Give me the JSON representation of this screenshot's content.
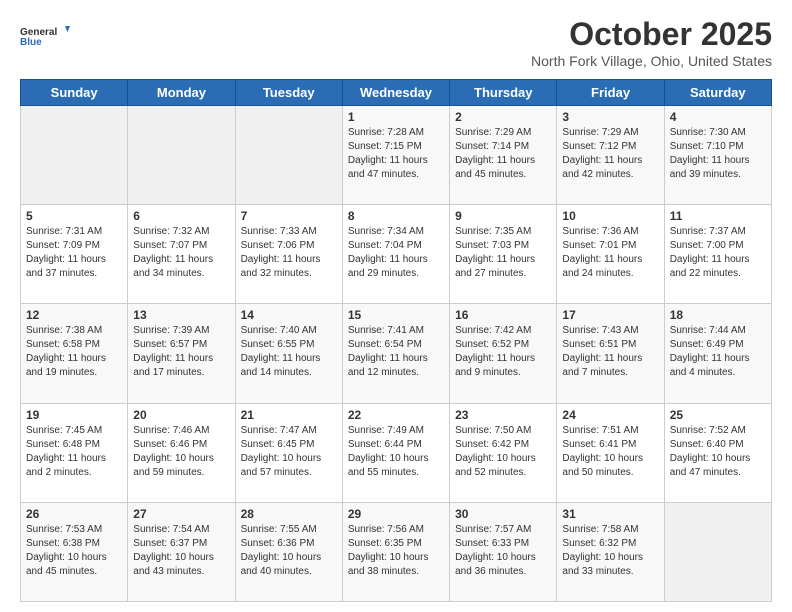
{
  "logo": {
    "line1": "General",
    "line2": "Blue"
  },
  "header": {
    "month": "October 2025",
    "location": "North Fork Village, Ohio, United States"
  },
  "days_of_week": [
    "Sunday",
    "Monday",
    "Tuesday",
    "Wednesday",
    "Thursday",
    "Friday",
    "Saturday"
  ],
  "weeks": [
    [
      {
        "day": "",
        "info": ""
      },
      {
        "day": "",
        "info": ""
      },
      {
        "day": "",
        "info": ""
      },
      {
        "day": "1",
        "info": "Sunrise: 7:28 AM\nSunset: 7:15 PM\nDaylight: 11 hours\nand 47 minutes."
      },
      {
        "day": "2",
        "info": "Sunrise: 7:29 AM\nSunset: 7:14 PM\nDaylight: 11 hours\nand 45 minutes."
      },
      {
        "day": "3",
        "info": "Sunrise: 7:29 AM\nSunset: 7:12 PM\nDaylight: 11 hours\nand 42 minutes."
      },
      {
        "day": "4",
        "info": "Sunrise: 7:30 AM\nSunset: 7:10 PM\nDaylight: 11 hours\nand 39 minutes."
      }
    ],
    [
      {
        "day": "5",
        "info": "Sunrise: 7:31 AM\nSunset: 7:09 PM\nDaylight: 11 hours\nand 37 minutes."
      },
      {
        "day": "6",
        "info": "Sunrise: 7:32 AM\nSunset: 7:07 PM\nDaylight: 11 hours\nand 34 minutes."
      },
      {
        "day": "7",
        "info": "Sunrise: 7:33 AM\nSunset: 7:06 PM\nDaylight: 11 hours\nand 32 minutes."
      },
      {
        "day": "8",
        "info": "Sunrise: 7:34 AM\nSunset: 7:04 PM\nDaylight: 11 hours\nand 29 minutes."
      },
      {
        "day": "9",
        "info": "Sunrise: 7:35 AM\nSunset: 7:03 PM\nDaylight: 11 hours\nand 27 minutes."
      },
      {
        "day": "10",
        "info": "Sunrise: 7:36 AM\nSunset: 7:01 PM\nDaylight: 11 hours\nand 24 minutes."
      },
      {
        "day": "11",
        "info": "Sunrise: 7:37 AM\nSunset: 7:00 PM\nDaylight: 11 hours\nand 22 minutes."
      }
    ],
    [
      {
        "day": "12",
        "info": "Sunrise: 7:38 AM\nSunset: 6:58 PM\nDaylight: 11 hours\nand 19 minutes."
      },
      {
        "day": "13",
        "info": "Sunrise: 7:39 AM\nSunset: 6:57 PM\nDaylight: 11 hours\nand 17 minutes."
      },
      {
        "day": "14",
        "info": "Sunrise: 7:40 AM\nSunset: 6:55 PM\nDaylight: 11 hours\nand 14 minutes."
      },
      {
        "day": "15",
        "info": "Sunrise: 7:41 AM\nSunset: 6:54 PM\nDaylight: 11 hours\nand 12 minutes."
      },
      {
        "day": "16",
        "info": "Sunrise: 7:42 AM\nSunset: 6:52 PM\nDaylight: 11 hours\nand 9 minutes."
      },
      {
        "day": "17",
        "info": "Sunrise: 7:43 AM\nSunset: 6:51 PM\nDaylight: 11 hours\nand 7 minutes."
      },
      {
        "day": "18",
        "info": "Sunrise: 7:44 AM\nSunset: 6:49 PM\nDaylight: 11 hours\nand 4 minutes."
      }
    ],
    [
      {
        "day": "19",
        "info": "Sunrise: 7:45 AM\nSunset: 6:48 PM\nDaylight: 11 hours\nand 2 minutes."
      },
      {
        "day": "20",
        "info": "Sunrise: 7:46 AM\nSunset: 6:46 PM\nDaylight: 10 hours\nand 59 minutes."
      },
      {
        "day": "21",
        "info": "Sunrise: 7:47 AM\nSunset: 6:45 PM\nDaylight: 10 hours\nand 57 minutes."
      },
      {
        "day": "22",
        "info": "Sunrise: 7:49 AM\nSunset: 6:44 PM\nDaylight: 10 hours\nand 55 minutes."
      },
      {
        "day": "23",
        "info": "Sunrise: 7:50 AM\nSunset: 6:42 PM\nDaylight: 10 hours\nand 52 minutes."
      },
      {
        "day": "24",
        "info": "Sunrise: 7:51 AM\nSunset: 6:41 PM\nDaylight: 10 hours\nand 50 minutes."
      },
      {
        "day": "25",
        "info": "Sunrise: 7:52 AM\nSunset: 6:40 PM\nDaylight: 10 hours\nand 47 minutes."
      }
    ],
    [
      {
        "day": "26",
        "info": "Sunrise: 7:53 AM\nSunset: 6:38 PM\nDaylight: 10 hours\nand 45 minutes."
      },
      {
        "day": "27",
        "info": "Sunrise: 7:54 AM\nSunset: 6:37 PM\nDaylight: 10 hours\nand 43 minutes."
      },
      {
        "day": "28",
        "info": "Sunrise: 7:55 AM\nSunset: 6:36 PM\nDaylight: 10 hours\nand 40 minutes."
      },
      {
        "day": "29",
        "info": "Sunrise: 7:56 AM\nSunset: 6:35 PM\nDaylight: 10 hours\nand 38 minutes."
      },
      {
        "day": "30",
        "info": "Sunrise: 7:57 AM\nSunset: 6:33 PM\nDaylight: 10 hours\nand 36 minutes."
      },
      {
        "day": "31",
        "info": "Sunrise: 7:58 AM\nSunset: 6:32 PM\nDaylight: 10 hours\nand 33 minutes."
      },
      {
        "day": "",
        "info": ""
      }
    ]
  ]
}
